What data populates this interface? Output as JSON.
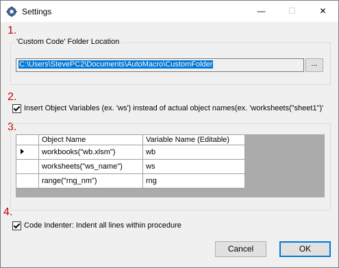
{
  "window": {
    "title": "Settings",
    "min_label": "—",
    "max_label": "☐",
    "close_label": "✕"
  },
  "sections": {
    "n1": "1.",
    "n2": "2.",
    "n3": "3.",
    "n4": "4."
  },
  "folder": {
    "legend": "'Custom Code' Folder Location",
    "path": "C:\\Users\\StevePC2\\Documents\\AutoMacro\\CustomFolder",
    "browse_label": "..."
  },
  "insert_vars": {
    "checked": true,
    "label": "Insert Object Variables (ex. 'ws') instead of actual object names(ex. 'worksheets(\"sheet1\")'"
  },
  "grid": {
    "columns": [
      "Object Name",
      "Variable Name (Editable)"
    ],
    "rows": [
      {
        "object": "workbooks(\"wb.xlsm\")",
        "variable": "wb",
        "current": true
      },
      {
        "object": "worksheets(\"ws_name\")",
        "variable": "ws",
        "current": false
      },
      {
        "object": "range(\"rng_nm\")",
        "variable": "rng",
        "current": false
      }
    ]
  },
  "indenter": {
    "checked": true,
    "label": "Code Indenter: Indent all lines within procedure"
  },
  "buttons": {
    "cancel": "Cancel",
    "ok": "OK"
  },
  "colors": {
    "section_number": "#c00000",
    "selection": "#0078d7",
    "grid_background": "#ababab"
  }
}
